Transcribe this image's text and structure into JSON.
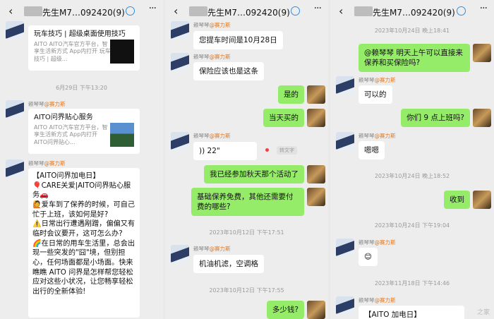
{
  "header": {
    "title": "先生M7…092420(9)",
    "back_icon": "‹",
    "more_icon": "···"
  },
  "panel1": {
    "card1": {
      "title": "玩车技巧 | 超级桌面使用技巧",
      "desc": "AITO AITO汽车官方平台，智享生活新方式 App内打开 玩车技巧 | 超级..."
    },
    "ts1": "6月29日 下午13:20",
    "nick": "赖琴琴",
    "org": "@赛力斯",
    "card2": {
      "title": "AITO问界贴心服务",
      "desc": "AITO AITO汽车官方平台，智享生活新方式 App内打开 AITO问界贴心..."
    },
    "long_msg": "【AITO问界加电日】\n🎈CARE关爱|AITO问界贴心服务🚗\n🙋爱车到了保养的时候，可自己忙于上班，该如何是好?\n⚠️日常出行遭遇剐蹭，偏偏又有临时会议要开，这可怎么办?\n🌈在日常的用车生活里，总会出现一些突发的\"囧\"境，但别担心，任何场面都是小场面。快来瞧瞧 AITO 问界是怎样帮您轻松应对这些小状况，让您畅享轻松出行的全新体验!"
  },
  "panel2": {
    "m1": "您提车时间是10月28日",
    "m2": "保险应该也是这条",
    "m3": "是的",
    "m4": "当天买的",
    "nick": "赖琴琴",
    "org": "@赛力斯",
    "voice": ")) 22\"",
    "voice_btn": "转文字",
    "m5": "我已经参加秋天那个活动了",
    "m6": "基础保养免费，其他还需要付费的哪些?",
    "ts1": "2023年10月12日 下午17:51",
    "m7": "机油机滤，空调格",
    "ts2": "2023年10月12日 下午17:55",
    "m8": "多少钱?"
  },
  "panel3": {
    "ts1": "2023年10月24日 晚上18:41",
    "m1": "@赖琴琴  明天上午可以直接来保养和买保险吗?",
    "nick": "赖琴琴",
    "org": "@赛力斯",
    "m2": "可以的",
    "m3": "你们 9 点上班吗?",
    "m4": "嗯嗯",
    "ts2": "2023年10月24日 晚上18:52",
    "m5": "收到",
    "ts3": "2023年10月24日 下午19:04",
    "m6": "😊",
    "ts4": "2023年11月18日 下午14:46",
    "m7": "【AITO 加电日】",
    "watermark": "之家"
  }
}
